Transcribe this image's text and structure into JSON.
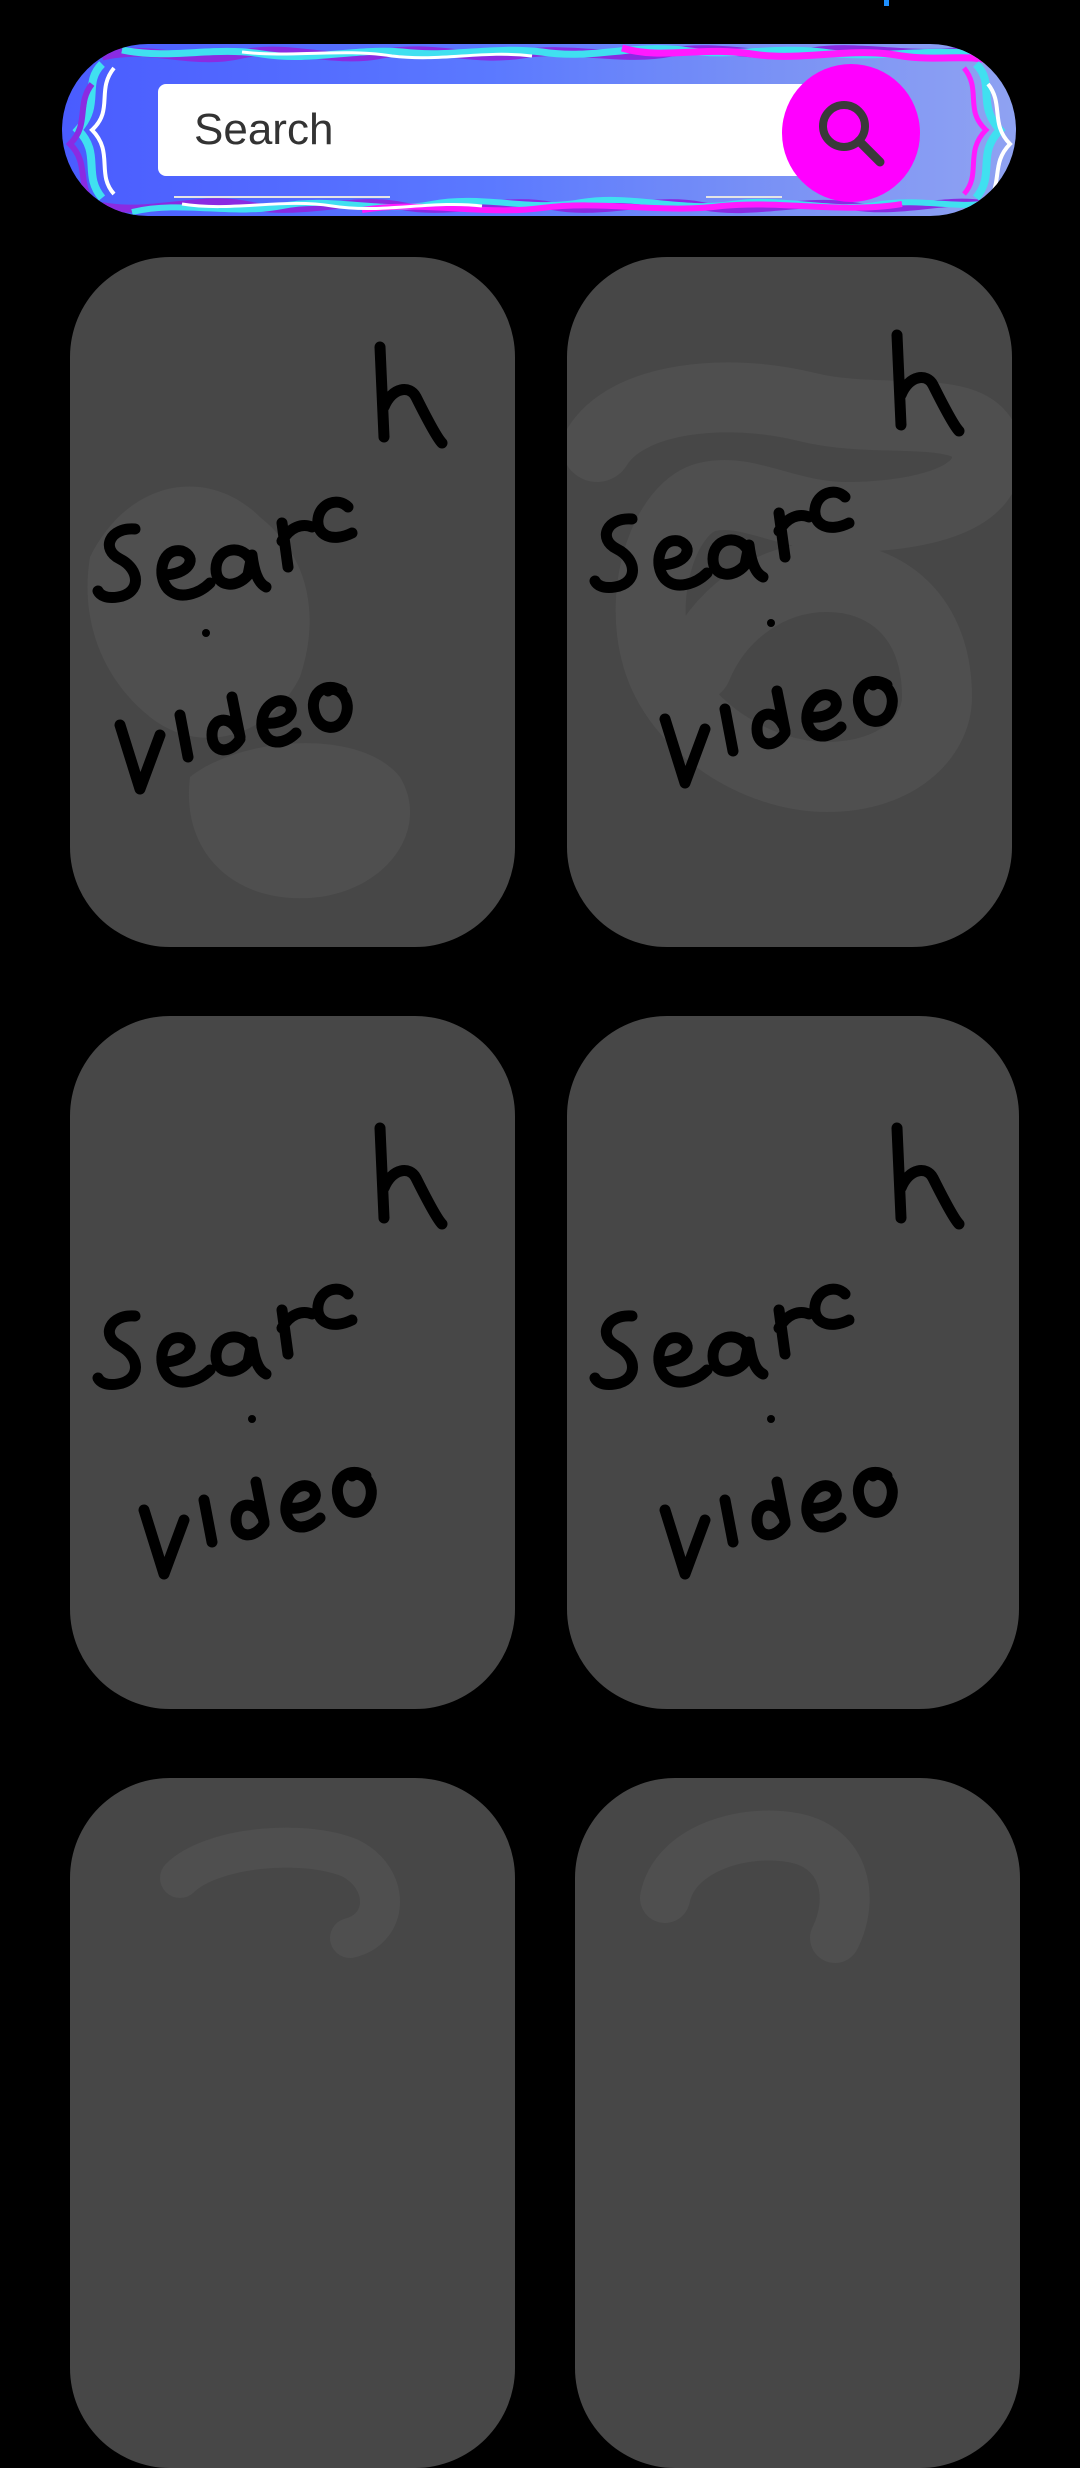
{
  "search": {
    "placeholder": "Search",
    "button_icon": "search-icon",
    "button_color": "#ff00ff",
    "bar_gradient_colors": [
      "#4a5cff",
      "#8fa2f2"
    ],
    "wave_colors": [
      "#8a2be2",
      "#40e0f0",
      "#ff1aff",
      "#ffffff"
    ]
  },
  "video_grid": {
    "tiles": [
      {
        "line1": "search",
        "line2": "video"
      },
      {
        "line1": "search",
        "line2": "video"
      },
      {
        "line1": "search",
        "line2": "video"
      },
      {
        "line1": "search",
        "line2": "video"
      },
      {
        "line1": "",
        "line2": ""
      },
      {
        "line1": "",
        "line2": ""
      }
    ],
    "tile_color": "#474747"
  }
}
